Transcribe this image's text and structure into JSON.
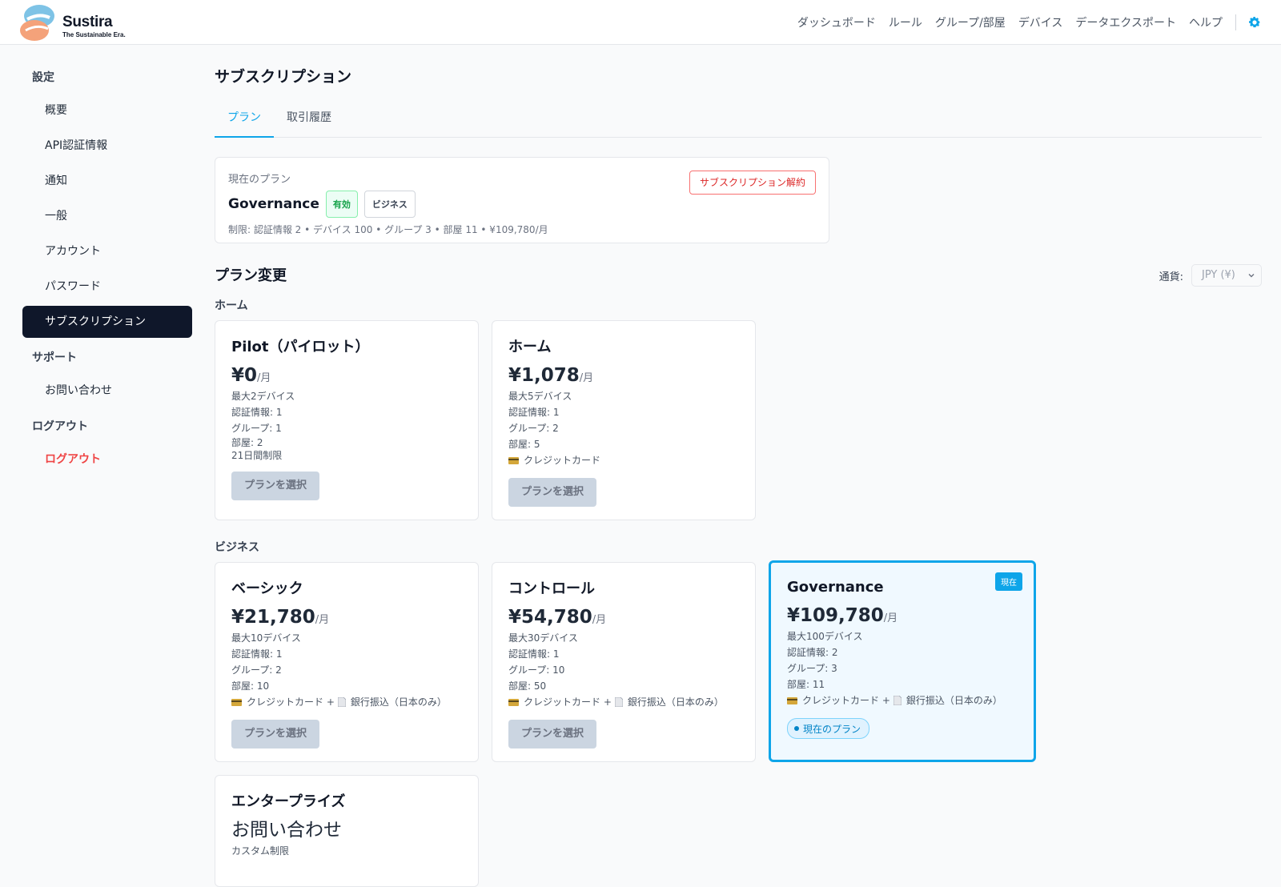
{
  "brand": {
    "name": "Sustira",
    "tagline": "The Sustainable Era."
  },
  "topnav": [
    "ダッシュボード",
    "ルール",
    "グループ/部屋",
    "デバイス",
    "データエクスポート",
    "ヘルプ"
  ],
  "sidebar": {
    "settings_heading": "設定",
    "settings_items": [
      "概要",
      "API認証情報",
      "通知",
      "一般",
      "アカウント",
      "パスワード",
      "サブスクリプション"
    ],
    "support_heading": "サポート",
    "support_items": [
      "お問い合わせ"
    ],
    "logout_heading": "ログアウト",
    "logout_item": "ログアウト"
  },
  "page": {
    "title": "サブスクリプション",
    "tabs": [
      "プラン",
      "取引履歴"
    ]
  },
  "current_plan": {
    "label": "現在のプラン",
    "name": "Governance",
    "status": "有効",
    "category": "ビジネス",
    "limits": "制限: 認証情報 2 • デバイス 100 • グループ 3 • 部屋 11 • ¥109,780/月",
    "cancel_label": "サブスクリプション解約"
  },
  "change": {
    "title": "プラン変更",
    "currency_label": "通貨:",
    "currency_value": "JPY (¥)"
  },
  "groups": {
    "home": {
      "title": "ホーム",
      "plans": [
        {
          "name": "Pilot（パイロット）",
          "price": "¥0",
          "unit": "/月",
          "devices": "最大2デバイス",
          "credentials": "認証情報: 1",
          "groups": "グループ: 1",
          "rooms": "部屋: 2",
          "extra": "21日間制限",
          "button": "プランを選択"
        },
        {
          "name": "ホーム",
          "price": "¥1,078",
          "unit": "/月",
          "devices": "最大5デバイス",
          "credentials": "認証情報: 1",
          "groups": "グループ: 2",
          "rooms": "部屋: 5",
          "payment": "クレジットカード",
          "button": "プランを選択"
        }
      ]
    },
    "business": {
      "title": "ビジネス",
      "plans": [
        {
          "name": "ベーシック",
          "price": "¥21,780",
          "unit": "/月",
          "devices": "最大10デバイス",
          "credentials": "認証情報: 1",
          "groups": "グループ: 2",
          "rooms": "部屋: 10",
          "payment_card": "クレジットカード +",
          "payment_bank": "銀行振込（日本のみ）",
          "button": "プランを選択"
        },
        {
          "name": "コントロール",
          "price": "¥54,780",
          "unit": "/月",
          "devices": "最大30デバイス",
          "credentials": "認証情報: 1",
          "groups": "グループ: 10",
          "rooms": "部屋: 50",
          "payment_card": "クレジットカード +",
          "payment_bank": "銀行振込（日本のみ）",
          "button": "プランを選択"
        },
        {
          "name": "Governance",
          "price": "¥109,780",
          "unit": "/月",
          "devices": "最大100デバイス",
          "credentials": "認証情報: 2",
          "groups": "グループ: 3",
          "rooms": "部屋: 11",
          "payment_card": "クレジットカード +",
          "payment_bank": "銀行振込（日本のみ）",
          "current_tag": "現在",
          "current_pill": "現在のプラン"
        }
      ]
    },
    "enterprise": {
      "plans": [
        {
          "name": "エンタープライズ",
          "price": "お問い合わせ",
          "devices": "カスタム制限"
        }
      ]
    }
  },
  "colors": {
    "accent": "#0ea5e9",
    "sidebar_active": "#0f172a",
    "danger": "#ef4444",
    "success": "#16a34a"
  }
}
